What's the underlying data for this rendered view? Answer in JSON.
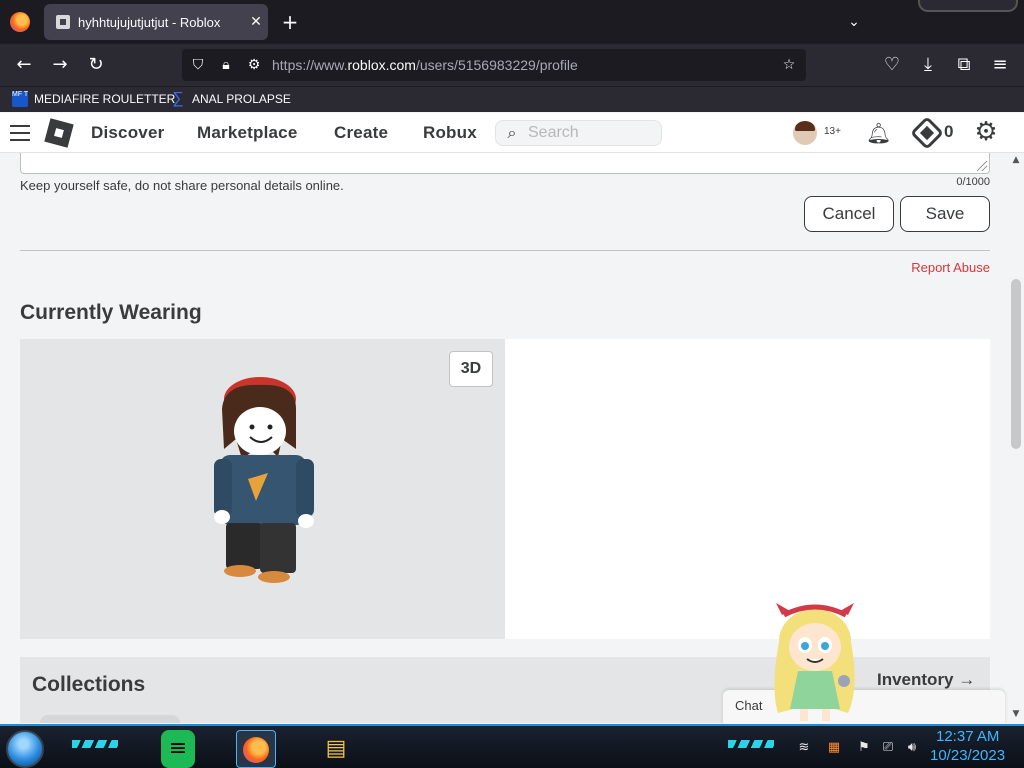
{
  "browser": {
    "tab_title": "hyhhtujujutjutjut - Roblox",
    "url_prefix": "https://www.",
    "url_domain": "roblox.com",
    "url_path": "/users/5156983229/profile",
    "bookmarks": [
      {
        "label": "MEDIAFIRE ROULETTER",
        "icon_text": "MF T"
      },
      {
        "label": "ANAL PROLAPSE"
      }
    ]
  },
  "header": {
    "nav": [
      "Discover",
      "Marketplace",
      "Create",
      "Robux"
    ],
    "search_placeholder": "Search",
    "age_badge": "13+",
    "robux_count": "0"
  },
  "profile": {
    "safety_note": "Keep yourself safe, do not share personal details online.",
    "char_counter": "0/1000",
    "cancel_label": "Cancel",
    "save_label": "Save",
    "report_label": "Report Abuse",
    "wearing_title": "Currently Wearing",
    "toggle_3d_label": "3D",
    "collections_title": "Collections",
    "inventory_label": "Inventory →"
  },
  "chat": {
    "label": "Chat"
  },
  "taskbar": {
    "time": "12:37 AM",
    "date": "10/23/2023"
  },
  "colors": {
    "accent_red": "#d8353b",
    "text_dark": "#393b3d",
    "taskbar_accent": "#3fb6ff"
  }
}
